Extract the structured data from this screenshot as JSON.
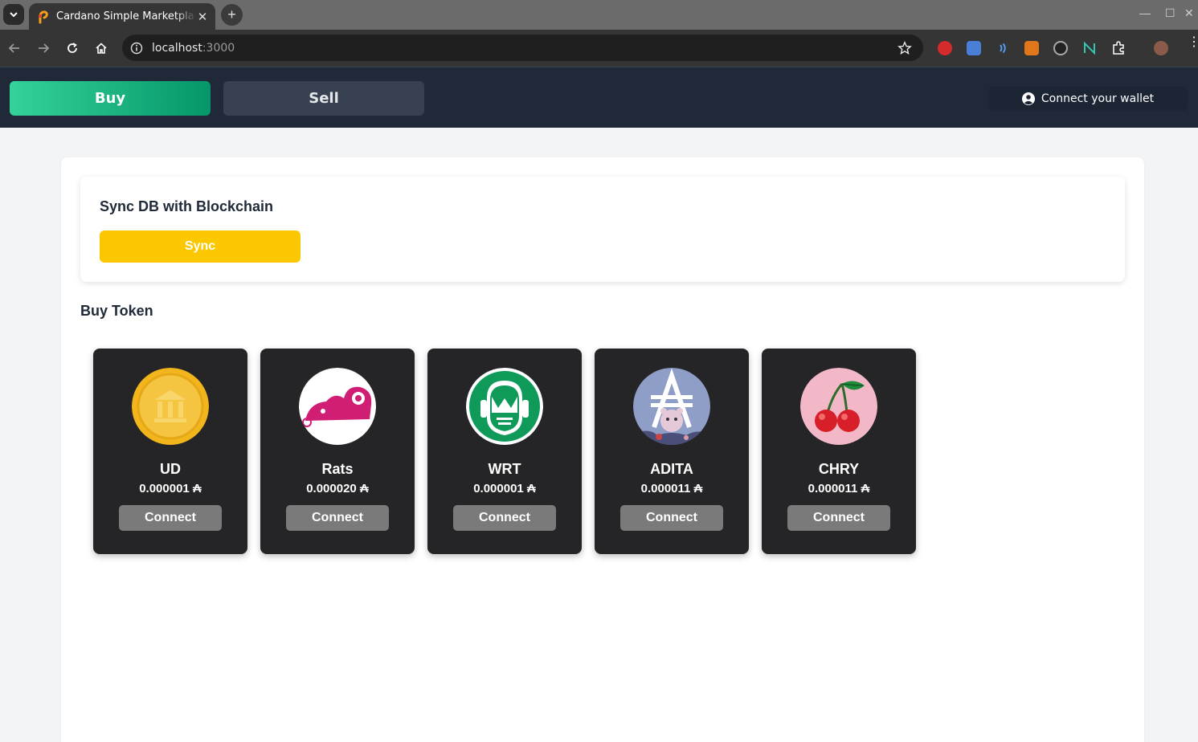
{
  "browser": {
    "tab_title": "Cardano Simple Marketplace",
    "url_host": "localhost",
    "url_port": ":3000"
  },
  "header": {
    "buy_label": "Buy",
    "sell_label": "Sell",
    "wallet_label": "Connect your wallet"
  },
  "sync": {
    "title": "Sync DB with Blockchain",
    "button_label": "Sync"
  },
  "buy_section": {
    "title": "Buy Token"
  },
  "tokens": [
    {
      "name": "UD",
      "price": "0.000001 ₳",
      "button": "Connect",
      "icon": "bank-coin-icon"
    },
    {
      "name": "Rats",
      "price": "0.000020 ₳",
      "button": "Connect",
      "icon": "rat-icon"
    },
    {
      "name": "WRT",
      "price": "0.000001 ₳",
      "button": "Connect",
      "icon": "warrior-mask-icon"
    },
    {
      "name": "ADITA",
      "price": "0.000011 ₳",
      "button": "Connect",
      "icon": "ada-bear-icon"
    },
    {
      "name": "CHRY",
      "price": "0.000011 ₳",
      "button": "Connect",
      "icon": "cherry-icon"
    }
  ],
  "colors": {
    "header_bg": "#1f2937",
    "buy_gradient_start": "#34d399",
    "buy_gradient_end": "#059669",
    "sync_yellow": "#fbc700",
    "token_card_bg": "#252527"
  }
}
